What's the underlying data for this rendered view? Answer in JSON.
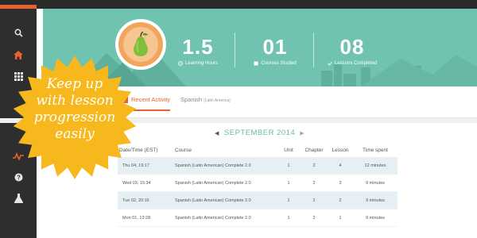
{
  "colors": {
    "banner": "#6fc3b0",
    "accent": "#e8632c",
    "sidebar": "#2e2e2e",
    "badge": "#f6b81c",
    "month_title": "#6db9a2",
    "row_alt": "#e6eff4"
  },
  "sidebar": {
    "icons": [
      "search-icon",
      "home-icon",
      "grid-icon",
      "activity-icon",
      "help-icon",
      "flask-icon"
    ],
    "active": "home-icon"
  },
  "stats": [
    {
      "value": "1.5",
      "label": "Learning Hours",
      "icon": "clock-icon"
    },
    {
      "value": "01",
      "label": "Courses Studied",
      "icon": "book-icon"
    },
    {
      "value": "08",
      "label": "Lessons Completed",
      "icon": "check-icon"
    }
  ],
  "tabs": {
    "recent": "Recent Activity",
    "course": "Spanish",
    "course_sub": "(Latin America)"
  },
  "calendar": {
    "month": "SEPTEMBER 2014",
    "prev": "◀",
    "next": "▶"
  },
  "table": {
    "headers": [
      "Date/Time (EST)",
      "Course",
      "Unit",
      "Chapter",
      "Lesson",
      "Time spent"
    ],
    "rows": [
      [
        "Thu 04, 19:17",
        "Spanish (Latin American) Complete 2.0",
        "1",
        "2",
        "4",
        "12 minutes"
      ],
      [
        "Wed 03, 15:34",
        "Spanish (Latin American) Complete 2.0",
        "1",
        "2",
        "3",
        "9 minutes"
      ],
      [
        "Tue 02, 20:16",
        "Spanish (Latin American) Complete 2.0",
        "1",
        "2",
        "2",
        "9 minutes"
      ],
      [
        "Mon 01, 13:28",
        "Spanish (Latin American) Complete 2.0",
        "1",
        "2",
        "1",
        "9 minutes"
      ]
    ]
  },
  "badge": {
    "lines": [
      "Keep up",
      "with lesson",
      "progression",
      "easily"
    ]
  }
}
